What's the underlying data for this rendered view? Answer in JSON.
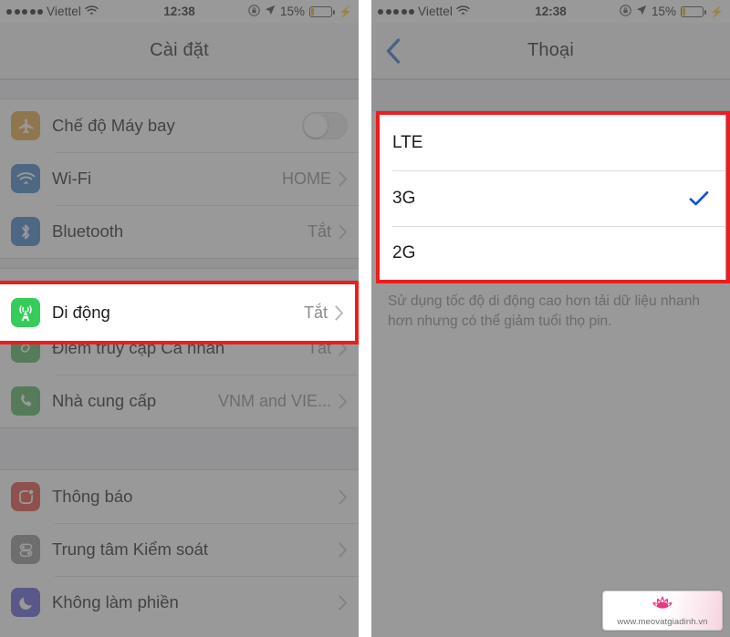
{
  "statusbar": {
    "signal_dots": 5,
    "carrier": "Viettel",
    "wifi_icon": "wifi-icon",
    "time": "12:38",
    "rotation_lock_icon": "rotation-lock-icon",
    "location_icon": "location-arrow-icon",
    "battery_percent": "15%",
    "battery_level": 15,
    "charging_icon": "lightning-bolt-icon",
    "battery_color": "#e8b917"
  },
  "left_panel": {
    "nav": {
      "title": "Cài đặt"
    },
    "groups": [
      {
        "rows": [
          {
            "icon": "airplane-icon",
            "icon_color": "#e8a33d",
            "label": "Chế độ Máy bay",
            "control": "switch",
            "switch_on": false
          },
          {
            "icon": "wifi-icon",
            "icon_color": "#3c7fc4",
            "label": "Wi-Fi",
            "value": "HOME",
            "control": "chevron"
          },
          {
            "icon": "bluetooth-icon",
            "icon_color": "#3c7fc4",
            "label": "Bluetooth",
            "value": "Tắt",
            "control": "chevron"
          }
        ]
      },
      {
        "rows": [
          {
            "icon": "cellular-tower-icon",
            "icon_color": "#35cd5a",
            "label": "Di động",
            "value": "Tắt",
            "control": "chevron",
            "highlighted": true
          },
          {
            "icon": "hotspot-icon",
            "icon_color": "#4cb05e",
            "label": "Điểm truy cập Cá nhân",
            "value": "Tắt",
            "control": "chevron"
          },
          {
            "icon": "phone-icon",
            "icon_color": "#4cb05e",
            "label": "Nhà cung cấp",
            "value": "VNM and VIE...",
            "control": "chevron"
          }
        ]
      },
      {
        "rows": [
          {
            "icon": "notifications-icon",
            "icon_color": "#e3433a",
            "label": "Thông báo",
            "control": "chevron"
          },
          {
            "icon": "control-center-icon",
            "icon_color": "#8e8e93",
            "label": "Trung tâm Kiểm soát",
            "control": "chevron"
          },
          {
            "icon": "do-not-disturb-moon-icon",
            "icon_color": "#5856d6",
            "label": "Không làm phiền",
            "control": "chevron"
          }
        ]
      }
    ]
  },
  "right_panel": {
    "nav": {
      "back_icon": "chevron-left-icon",
      "title": "Thoại"
    },
    "options": [
      {
        "label": "LTE",
        "selected": false
      },
      {
        "label": "3G",
        "selected": true
      },
      {
        "label": "2G",
        "selected": false
      }
    ],
    "footnote": "Sử dụng tốc độ di động cao hơn tải dữ liệu nhanh hơn nhưng có thể giảm tuổi thọ pin."
  },
  "highlight_color": "#ee1c1c",
  "accent_color": "#007aff",
  "watermark": {
    "url": "www.meovatgiadinh.vn",
    "logo_icon": "lotus-flower-icon",
    "logo_color": "#e8387f"
  }
}
